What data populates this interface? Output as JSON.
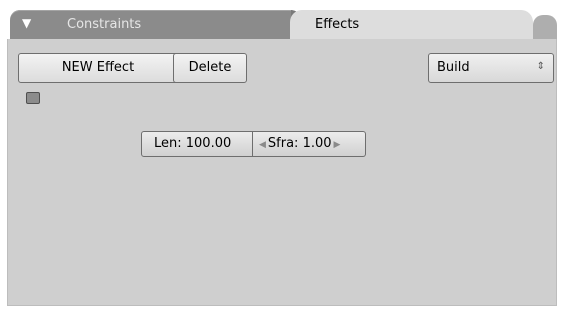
{
  "tabs": {
    "inactive": "Constraints",
    "active": "Effects"
  },
  "toolbar": {
    "new_effect_label": "NEW Effect",
    "delete_label": "Delete"
  },
  "effect_type": {
    "selected": "Build"
  },
  "fields": {
    "len": "Len: 100.00",
    "sfra": "Sfra: 1.00"
  },
  "icons": {
    "collapse": "triangle-down-icon",
    "spinner": "up-down-arrows-icon",
    "left_arrow": "left-arrow-icon",
    "right_arrow": "right-arrow-icon"
  },
  "colors": {
    "panel_bg": "#cfcfcf",
    "tab_inactive": "#8b8b8b",
    "tab_active": "#dddddd"
  }
}
